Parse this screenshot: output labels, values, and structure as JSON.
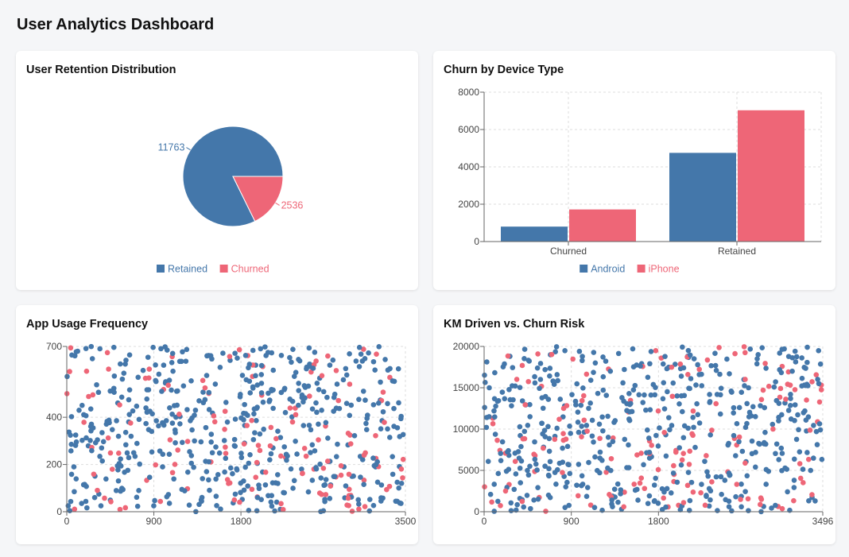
{
  "page": {
    "title": "User Analytics Dashboard"
  },
  "colors": {
    "android": "#4477aa",
    "iphone": "#ee6677",
    "retained": "#4477aa",
    "churned": "#ee6677"
  },
  "chart_data": [
    {
      "type": "pie",
      "title": "User Retention Distribution",
      "slices": [
        {
          "label": "Retained",
          "value": 11763,
          "color": "#4477aa"
        },
        {
          "label": "Churned",
          "value": 2536,
          "color": "#ee6677"
        }
      ],
      "legend": [
        {
          "label": "Retained",
          "color": "#4477aa"
        },
        {
          "label": "Churned",
          "color": "#ee6677"
        }
      ],
      "legend_position": "bottom"
    },
    {
      "type": "bar",
      "title": "Churn by Device Type",
      "categories": [
        "Churned",
        "Retained"
      ],
      "series": [
        {
          "name": "Android",
          "values": [
            800,
            4750
          ],
          "color": "#4477aa"
        },
        {
          "name": "iPhone",
          "values": [
            1720,
            7030
          ],
          "color": "#ee6677"
        }
      ],
      "ylim": [
        0,
        8000
      ],
      "yticks": [
        0,
        2000,
        4000,
        6000,
        8000
      ],
      "grid": true,
      "legend_position": "bottom"
    },
    {
      "type": "scatter",
      "title": "App Usage Frequency",
      "xlim": [
        0,
        3500
      ],
      "ylim": [
        0,
        700
      ],
      "xticks": [
        0,
        900,
        1800,
        3500
      ],
      "yticks": [
        0,
        200,
        400,
        700
      ],
      "grid": true,
      "n_points": 650,
      "churned_share": 0.2,
      "seed": 7
    },
    {
      "type": "scatter",
      "title": "KM Driven vs. Churn Risk",
      "xlim": [
        0,
        3496
      ],
      "ylim": [
        0,
        20000
      ],
      "xticks": [
        0,
        900,
        1800,
        3496
      ],
      "yticks": [
        0,
        5000,
        10000,
        15000,
        20000
      ],
      "grid": true,
      "n_points": 650,
      "churned_share": 0.2,
      "seed": 13
    }
  ]
}
